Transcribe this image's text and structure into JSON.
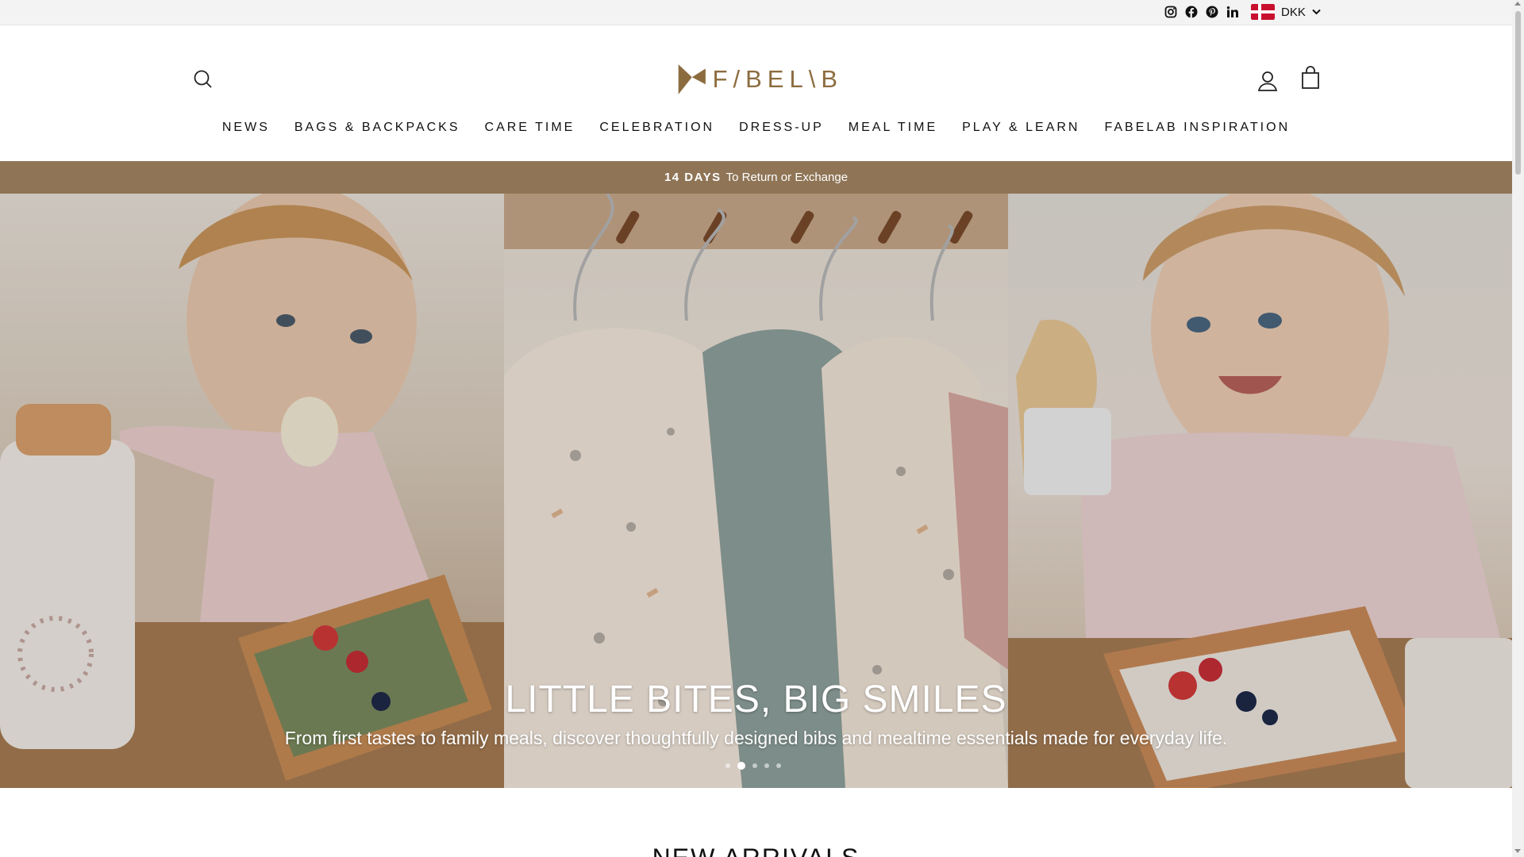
{
  "utility": {
    "social_icons": [
      "instagram-icon",
      "facebook-icon",
      "pinterest-icon",
      "linkedin-icon"
    ],
    "currency": {
      "code": "DKK",
      "flag": "denmark-flag-icon"
    }
  },
  "header": {
    "logo_text": "F/BEL\\B",
    "icons": {
      "search": "search-icon",
      "account": "user-icon",
      "cart": "shopping-bag-icon"
    },
    "nav": [
      "NEWS",
      "BAGS & BACKPACKS",
      "CARE TIME",
      "CELEBRATION",
      "DRESS-UP",
      "MEAL TIME",
      "PLAY & LEARN",
      "FABELAB INSPIRATION"
    ]
  },
  "announcement": {
    "bold": "14 DAYS",
    "text": "To Return or Exchange"
  },
  "hero": {
    "title": "LITTLE BITES, BIG SMILES",
    "subtitle": "From first tastes to family meals, discover thoughtfully designed bibs and mealtime essentials made for everyday life.",
    "slide_count": 5,
    "active_slide": 2
  },
  "section": {
    "heading": "NEW ARRIVALS"
  },
  "colors": {
    "accent": "#8f7556",
    "logo": "#8c6c3f",
    "flag_red": "#c8102e"
  }
}
